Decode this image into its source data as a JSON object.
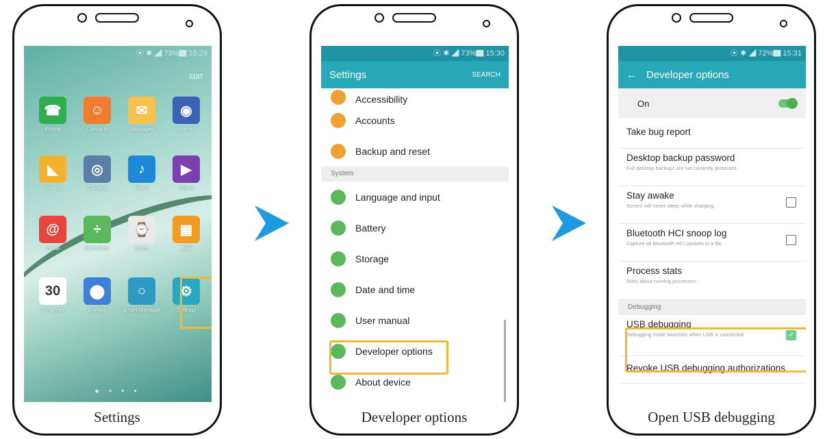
{
  "colors": {
    "accent": "#26a8b8",
    "highlight": "#f5b731",
    "arrow": "#1e9be0"
  },
  "phone1": {
    "status": "⦿ ✱ ◢ 73%▇ 15:29",
    "edit": "EDIT",
    "apps": [
      {
        "label": "Phone",
        "icon": "phone-icon",
        "glyph": "☎",
        "color": "#2fae4f"
      },
      {
        "label": "Contacts",
        "icon": "contacts-icon",
        "glyph": "☺",
        "color": "#f07c2f"
      },
      {
        "label": "Messages",
        "icon": "messages-icon",
        "glyph": "✉",
        "color": "#f6c24b"
      },
      {
        "label": "Internet",
        "icon": "internet-icon",
        "glyph": "◉",
        "color": "#3b63b5"
      },
      {
        "label": "Gallery",
        "icon": "gallery-icon",
        "glyph": "◣",
        "color": "#f3b230"
      },
      {
        "label": "Camera",
        "icon": "camera-icon",
        "glyph": "◎",
        "color": "#5b7ea8"
      },
      {
        "label": "Music",
        "icon": "music-icon",
        "glyph": "♪",
        "color": "#1e88d8"
      },
      {
        "label": "Video",
        "icon": "video-icon",
        "glyph": "▶",
        "color": "#7b3fb0"
      },
      {
        "label": "Email",
        "icon": "email-icon",
        "glyph": "@",
        "color": "#e8453c"
      },
      {
        "label": "Calculator",
        "icon": "calculator-icon",
        "glyph": "÷",
        "color": "#5cb85c"
      },
      {
        "label": "Clock",
        "icon": "clock-icon",
        "glyph": "⌚",
        "color": "#e9e9e9"
      },
      {
        "label": "工具",
        "icon": "tools-icon",
        "glyph": "▦",
        "color": "#f39c22"
      },
      {
        "label": "S Planner",
        "icon": "planner-icon",
        "glyph": "30",
        "color": "#ffffff"
      },
      {
        "label": "S Voice",
        "icon": "voice-icon",
        "glyph": "⬤",
        "color": "#3f7fd6"
      },
      {
        "label": "Smart Manager",
        "icon": "smart-manager-icon",
        "glyph": "○",
        "color": "#2c9ac4"
      },
      {
        "label": "Settings",
        "icon": "gear-icon",
        "glyph": "⚙",
        "color": "#2aa7c0"
      }
    ],
    "dots": "● • • •",
    "caption": "Settings"
  },
  "phone2": {
    "status": "⦿ ✱ ◢ 73%▇ 15:30",
    "title": "Settings",
    "search": "SEARCH",
    "top_partial": "Accessibility",
    "items_top": [
      {
        "label": "Accounts",
        "icon": "key-icon",
        "color": "#f0a030"
      },
      {
        "label": "Backup and reset",
        "icon": "backup-icon",
        "color": "#f0a030"
      }
    ],
    "section": "System",
    "items": [
      {
        "label": "Language and input",
        "icon": "language-icon",
        "color": "#5cb85c"
      },
      {
        "label": "Battery",
        "icon": "battery-icon",
        "color": "#5cb85c"
      },
      {
        "label": "Storage",
        "icon": "storage-icon",
        "color": "#5cb85c"
      },
      {
        "label": "Date and time",
        "icon": "calendar-icon",
        "color": "#5cb85c"
      },
      {
        "label": "User manual",
        "icon": "manual-icon",
        "color": "#5cb85c"
      },
      {
        "label": "Developer options",
        "icon": "developer-icon",
        "color": "#5cb85c"
      },
      {
        "label": "About device",
        "icon": "info-icon",
        "color": "#5cb85c"
      }
    ],
    "caption": "Developer options"
  },
  "phone3": {
    "status": "⦿ ✱ ◢ 72%▇ 15:31",
    "back": "←",
    "title": "Developer options",
    "on_label": "On",
    "rows": [
      {
        "title": "Take bug report",
        "sub": "",
        "checkbox": null
      },
      {
        "title": "Desktop backup password",
        "sub": "Full desktop backups are not currently protected.",
        "checkbox": null
      },
      {
        "title": "Stay awake",
        "sub": "Screen will never sleep while charging.",
        "checkbox": false
      },
      {
        "title": "Bluetooth HCI snoop log",
        "sub": "Capture all Bluetooth HCI packets in a file.",
        "checkbox": false
      },
      {
        "title": "Process stats",
        "sub": "Stats about running processes.",
        "checkbox": null
      }
    ],
    "section": "Debugging",
    "usb": {
      "title": "USB debugging",
      "sub": "Debugging mode launches when USB is connected.",
      "checked": true
    },
    "revoke": "Revoke USB debugging authorizations",
    "caption": "Open USB debugging"
  }
}
